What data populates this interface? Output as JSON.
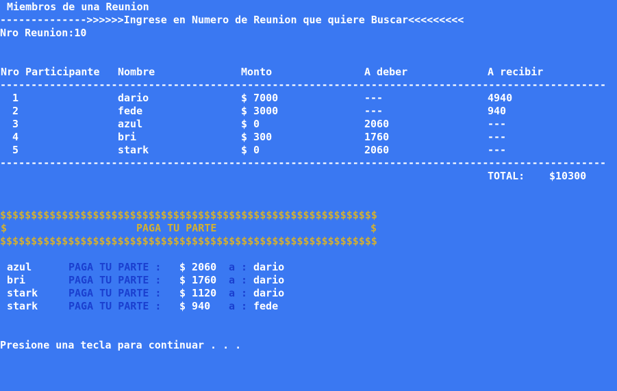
{
  "window_title": "Miembros de una Reunion",
  "prompt": "-------------->>>>>>Ingrese en Numero de Reunion que quiere Buscar<<<<<<<<<",
  "nro_reunion": "Nro Reunion:10",
  "table": {
    "headers": [
      "Nro Participante",
      "Nombre",
      "Monto",
      "A deber",
      "A recibir"
    ],
    "separator": "------------------------------------------------------------------------------------------------------------------------",
    "rows": [
      {
        "nro": "1",
        "nombre": "dario",
        "monto": "$ 7000",
        "deber": "---",
        "recibir": "4940"
      },
      {
        "nro": "2",
        "nombre": "fede",
        "monto": "$ 3000",
        "deber": "---",
        "recibir": "940"
      },
      {
        "nro": "3",
        "nombre": "azul",
        "monto": "$ 0",
        "deber": "2060",
        "recibir": "---"
      },
      {
        "nro": "4",
        "nombre": "bri",
        "monto": "$ 300",
        "deber": "1760",
        "recibir": "---"
      },
      {
        "nro": "5",
        "nombre": "stark",
        "monto": "$ 0",
        "deber": "2060",
        "recibir": "---"
      }
    ],
    "total_label": "TOTAL:",
    "total_value": "$10300"
  },
  "banner": {
    "border": "$$$$$$$$$$$$$$$$$$$$$$$$$$$$$$$$$$$$$$$$$$$$$$$$$$$$$$$$$$$$$",
    "side": "$",
    "text": "PAGA TU PARTE"
  },
  "payments": [
    {
      "from": "azul",
      "label": "PAGA TU PARTE :",
      "amount": "$ 2060",
      "a": "a :",
      "to": "dario"
    },
    {
      "from": "bri",
      "label": "PAGA TU PARTE :",
      "amount": "$ 1760",
      "a": "a :",
      "to": "dario"
    },
    {
      "from": "stark",
      "label": "PAGA TU PARTE :",
      "amount": "$ 1120",
      "a": "a :",
      "to": "dario"
    },
    {
      "from": "stark",
      "label": "PAGA TU PARTE :",
      "amount": "$ 940",
      "a": "a :",
      "to": "fede"
    }
  ],
  "continue_prompt": "Presione una tecla para continuar . . .",
  "colors": {
    "background": "#3a78f2",
    "text": "#ffffff",
    "banner": "#d4b030",
    "highlight": "#1a3fcf"
  }
}
